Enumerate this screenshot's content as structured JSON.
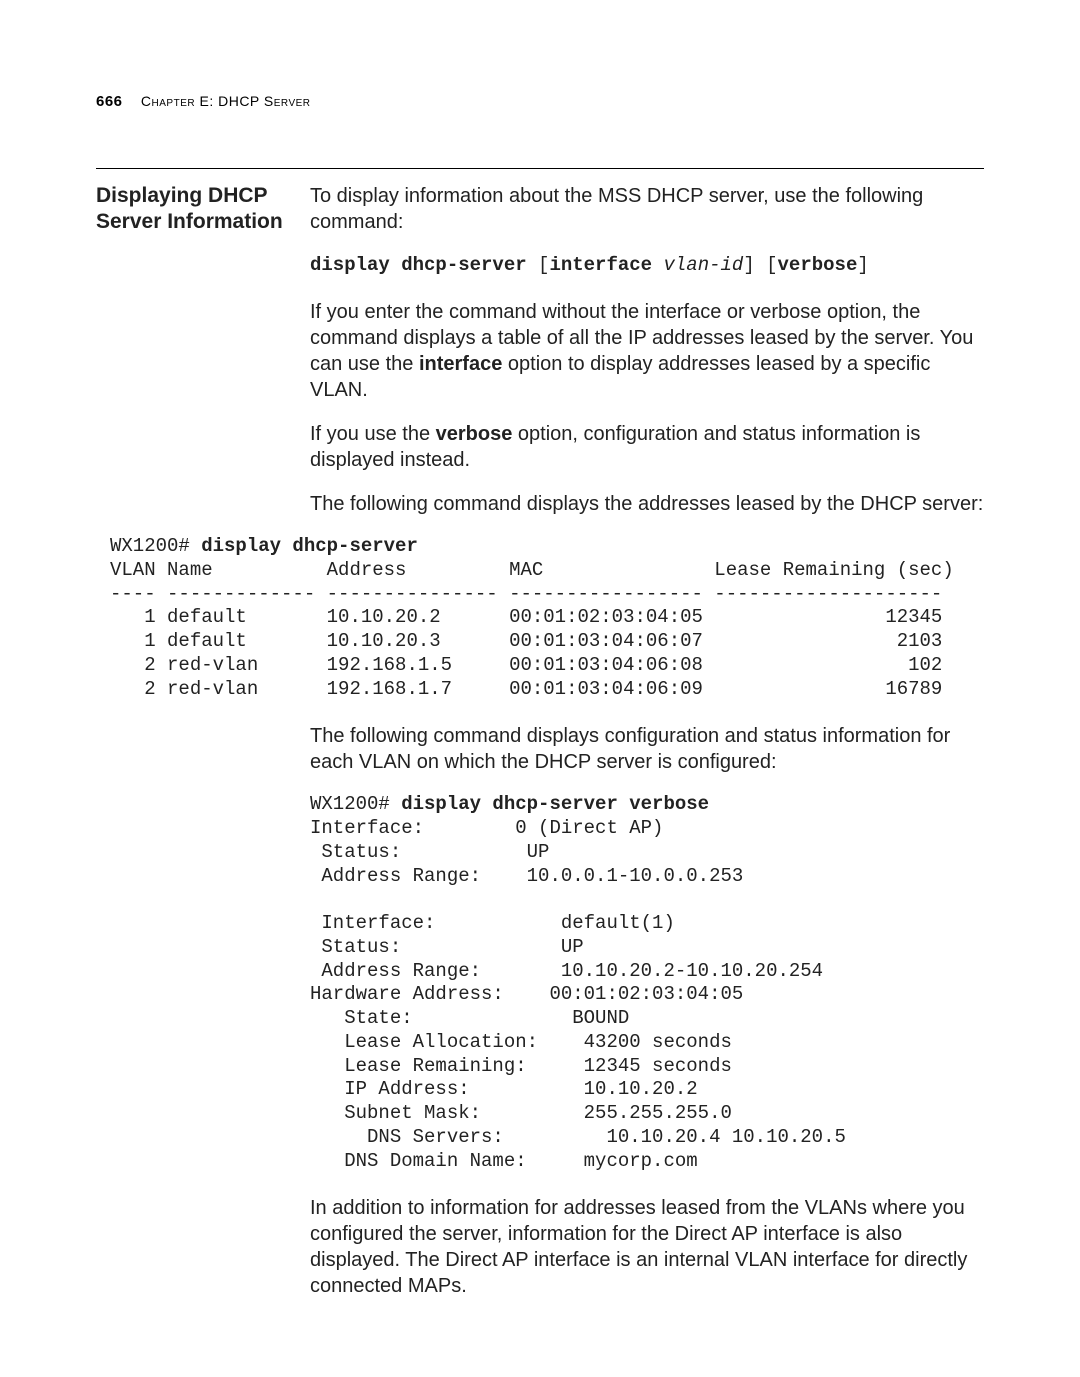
{
  "header": {
    "page_number": "666",
    "chapter_label": "Chapter E: DHCP Server"
  },
  "section": {
    "side_heading": "Displaying DHCP Server Information",
    "intro": "To display information about the MSS DHCP server, use the following command:",
    "syntax": {
      "cmd": "display dhcp-server",
      "opt1a": "[",
      "opt1_kw": "interface",
      "opt1_arg": "vlan-id",
      "opt1b": "]",
      "opt2a": " [",
      "opt2_kw": "verbose",
      "opt2b": "]"
    },
    "para_no_option_1": "If you enter the command without the interface or verbose option, the command displays a table of all the IP addresses leased by the server. You can use the ",
    "para_no_option_kw1": "interface",
    "para_no_option_2": " option to display addresses leased by a specific VLAN.",
    "para_verbose_1": "If you use the ",
    "para_verbose_kw": "verbose",
    "para_verbose_2": " option, configuration and status information is displayed instead.",
    "para_example1": "The following command displays the addresses leased by the DHCP server:",
    "example1_prompt": "WX1200# ",
    "example1_cmd": "display dhcp-server",
    "example1_body": "VLAN Name          Address         MAC               Lease Remaining (sec)\n---- ------------- --------------- ----------------- --------------------\n   1 default       10.10.20.2      00:01:02:03:04:05                12345\n   1 default       10.10.20.3      00:01:03:04:06:07                 2103\n   2 red-vlan      192.168.1.5     00:01:03:04:06:08                  102\n   2 red-vlan      192.168.1.7     00:01:03:04:06:09                16789",
    "para_example2": "The following command displays configuration and status information for each VLAN on which the DHCP server is configured:",
    "example2_prompt": "WX1200# ",
    "example2_cmd": "display dhcp-server verbose",
    "example2_body": "Interface:        0 (Direct AP)\n Status:           UP\n Address Range:    10.0.0.1-10.0.0.253\n\n Interface:           default(1)\n Status:              UP\n Address Range:       10.10.20.2-10.10.20.254\nHardware Address:    00:01:02:03:04:05\n   State:              BOUND\n   Lease Allocation:    43200 seconds\n   Lease Remaining:     12345 seconds\n   IP Address:          10.10.20.2\n   Subnet Mask:         255.255.255.0\n     DNS Servers:         10.10.20.4 10.10.20.5\n   DNS Domain Name:     mycorp.com",
    "para_additional": "In addition to information for addresses leased from the VLANs where you configured the server, information for the Direct AP interface is also displayed. The Direct AP interface is an internal VLAN interface for directly connected MAPs."
  }
}
